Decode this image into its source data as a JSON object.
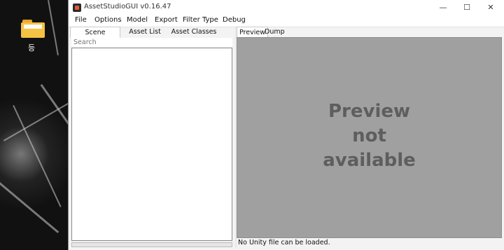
{
  "desktop": {
    "folder_label": "등"
  },
  "window": {
    "title": "AssetStudioGUI v0.16.47",
    "controls": {
      "minimize": "—",
      "maximize": "☐",
      "close": "✕"
    }
  },
  "menu": [
    "File",
    "Options",
    "Model",
    "Export",
    "Filter Type",
    "Debug"
  ],
  "left_panel": {
    "tabs": [
      "Scene Hierarchy",
      "Asset List",
      "Asset Classes"
    ],
    "active_tab": "Scene Hierarchy",
    "search_placeholder": "Search"
  },
  "right_panel": {
    "tabs": [
      "Preview",
      "Dump"
    ],
    "active_tab": "Preview",
    "preview_message": "Preview\nnot\navailable",
    "status": "No Unity file can be loaded."
  },
  "colors": {
    "preview_bg": "#a0a0a0",
    "preview_text": "#5e5e5e",
    "app_icon_accent": "#e8583b",
    "folder": "#f5c244"
  }
}
